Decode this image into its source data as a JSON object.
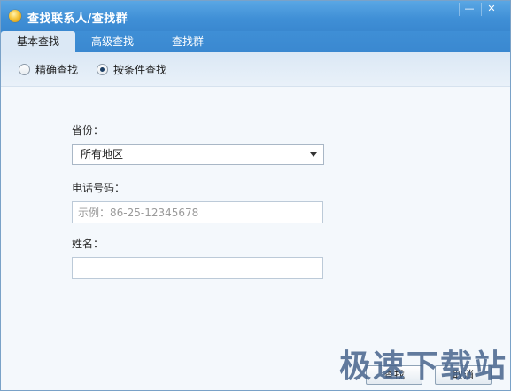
{
  "window": {
    "title": "查找联系人/查找群",
    "controls": {
      "minimize": "—",
      "close": "✕"
    }
  },
  "tabs": [
    {
      "label": "基本查找",
      "active": true
    },
    {
      "label": "高级查找",
      "active": false
    },
    {
      "label": "查找群",
      "active": false
    }
  ],
  "search_mode": {
    "options": [
      {
        "label": "精确查找",
        "checked": false
      },
      {
        "label": "按条件查找",
        "checked": true
      }
    ]
  },
  "form": {
    "province_label": "省份：",
    "province_value": "所有地区",
    "phone_label": "电话号码：",
    "phone_placeholder": "示例：86-25-12345678",
    "phone_value": "",
    "name_label": "姓名：",
    "name_value": ""
  },
  "buttons": {
    "search": "查找",
    "cancel": "取消"
  },
  "watermark": "极速下载站",
  "colors": {
    "titlebar": "#3f8fd6",
    "accent": "#1d3f66"
  }
}
